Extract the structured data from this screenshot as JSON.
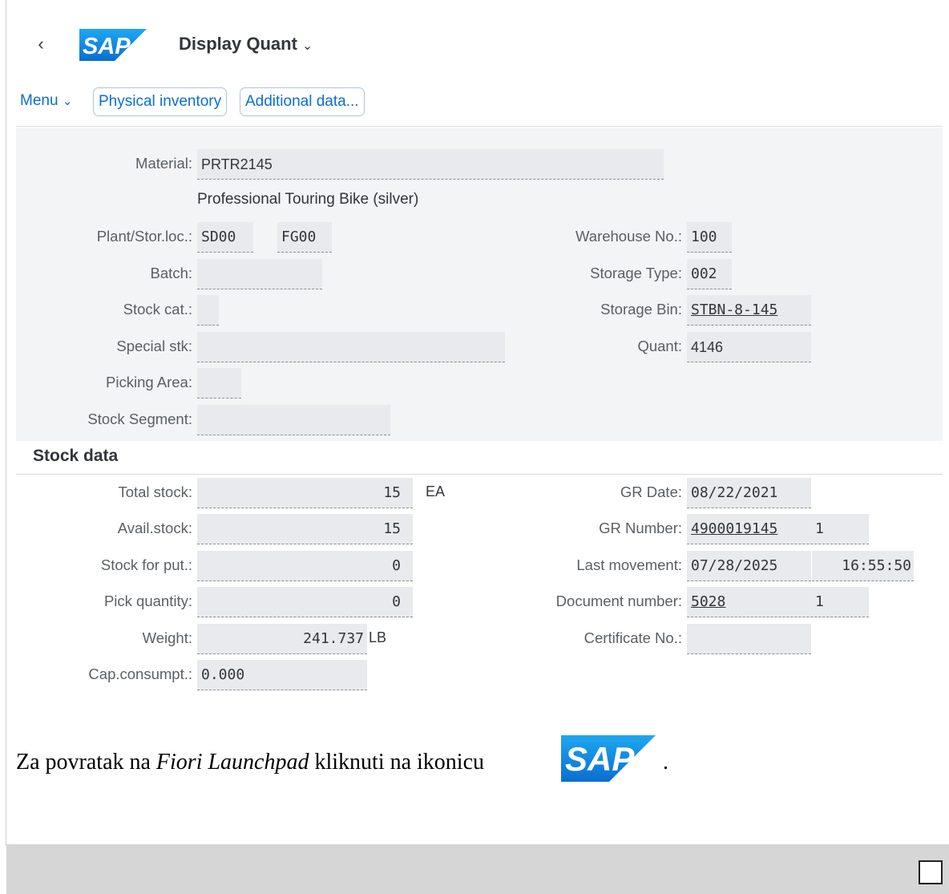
{
  "header": {
    "back_icon": "‹",
    "logo_text": "SAP",
    "title": "Display Quant",
    "title_chevron": "⌄"
  },
  "toolbar": {
    "menu_label": "Menu",
    "menu_chevron": "⌄",
    "physical_inventory": "Physical inventory",
    "additional_data": "Additional data..."
  },
  "general": {
    "material_label": "Material:",
    "material_value": "PRTR2145",
    "material_description": "Professional Touring Bike (silver)",
    "plant_label": "Plant/Stor.loc.:",
    "plant_value": "SD00",
    "storloc_value": "FG00",
    "batch_label": "Batch:",
    "batch_value": "",
    "stockcat_label": "Stock cat.:",
    "stockcat_value": "",
    "specialstk_label": "Special stk:",
    "specialstk_value": "",
    "pickingarea_label": "Picking Area:",
    "pickingarea_value": "",
    "stocksegment_label": "Stock Segment:",
    "stocksegment_value": "",
    "warehouse_label": "Warehouse No.:",
    "warehouse_value": "100",
    "storagetype_label": "Storage Type:",
    "storagetype_value": "002",
    "storagebin_label": "Storage Bin:",
    "storagebin_value": "STBN-8-145",
    "quant_label": "Quant:",
    "quant_value": "4146"
  },
  "stock": {
    "section_title": "Stock data",
    "total_label": "Total stock:",
    "total_value": "15",
    "total_unit": "EA",
    "avail_label": "Avail.stock:",
    "avail_value": "15",
    "put_label": "Stock for put.:",
    "put_value": "0",
    "pick_label": "Pick quantity:",
    "pick_value": "0",
    "weight_label": "Weight:",
    "weight_value": "241.737",
    "weight_unit": "LB",
    "cap_label": "Cap.consumpt.:",
    "cap_value": "0.000",
    "grdate_label": "GR Date:",
    "grdate_value": "08/22/2021",
    "grnumber_label": "GR Number:",
    "grnumber_value": "4900019145",
    "grnumber_item": "1",
    "lastmove_label": "Last movement:",
    "lastmove_date": "07/28/2025",
    "lastmove_time": "16:55:50",
    "docnum_label": "Document number:",
    "docnum_value": "5028",
    "docnum_item": "1",
    "cert_label": "Certificate No.:",
    "cert_value": ""
  },
  "doc": {
    "text_before": "Za povratak na ",
    "text_italic": "Fiori Launchpad",
    "text_after": " kliknuti na ikonicu",
    "text_end": "."
  },
  "colors": {
    "accent": "#0a6ed1",
    "panel_bg": "#f2f4f6",
    "footer_bg": "#d6d6d6"
  }
}
